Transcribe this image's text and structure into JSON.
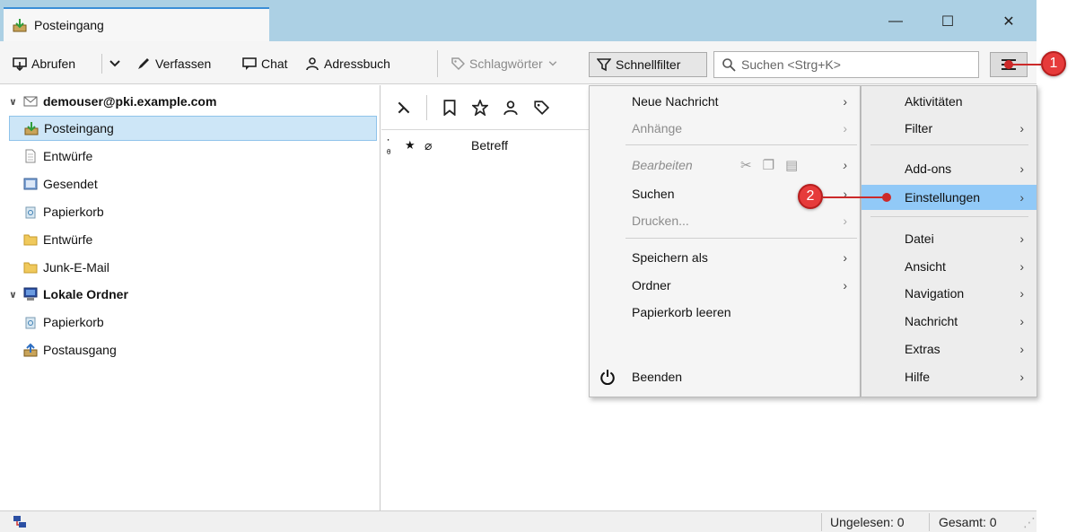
{
  "window": {
    "tab_title": "Posteingang",
    "controls": {
      "minimize": "—",
      "maximize": "☐",
      "close": "✕"
    }
  },
  "toolbar": {
    "get_messages": "Abrufen",
    "compose": "Verfassen",
    "chat": "Chat",
    "address_book": "Adressbuch",
    "tags": "Schlagwörter",
    "quick_filter": "Schnellfilter",
    "search_placeholder": "Suchen <Strg+K>"
  },
  "folders": [
    {
      "label": "demouser@pki.example.com",
      "type": "account"
    },
    {
      "label": "Posteingang",
      "type": "inbox",
      "selected": true
    },
    {
      "label": "Entwürfe",
      "type": "drafts"
    },
    {
      "label": "Gesendet",
      "type": "sent"
    },
    {
      "label": "Papierkorb",
      "type": "trash"
    },
    {
      "label": "Entwürfe",
      "type": "folder"
    },
    {
      "label": "Junk-E-Mail",
      "type": "folder"
    },
    {
      "label": "Lokale Ordner",
      "type": "account"
    },
    {
      "label": "Papierkorb",
      "type": "trash"
    },
    {
      "label": "Postausgang",
      "type": "outbox"
    }
  ],
  "thread": {
    "column_subject": "Betreff"
  },
  "app_menu_left": [
    {
      "label": "Neue Nachricht",
      "submenu": true,
      "disabled": false
    },
    {
      "label": "Anhänge",
      "submenu": true,
      "disabled": true
    },
    {
      "label": "Bearbeiten",
      "submenu": true,
      "disabled": true,
      "italic": true
    },
    {
      "label": "Suchen",
      "submenu": true,
      "disabled": false
    },
    {
      "label": "Drucken...",
      "submenu": true,
      "disabled": true
    },
    {
      "label": "Speichern als",
      "submenu": true,
      "disabled": false
    },
    {
      "label": "Ordner",
      "submenu": true,
      "disabled": false
    },
    {
      "label": "Papierkorb leeren",
      "submenu": false,
      "disabled": false
    },
    {
      "label": "Beenden",
      "submenu": false,
      "disabled": false
    }
  ],
  "app_menu_right": [
    {
      "label": "Aktivitäten",
      "submenu": false
    },
    {
      "label": "Filter",
      "submenu": true
    },
    {
      "label": "Add-ons",
      "submenu": true
    },
    {
      "label": "Einstellungen",
      "submenu": true,
      "highlight": true
    },
    {
      "label": "Datei",
      "submenu": true
    },
    {
      "label": "Ansicht",
      "submenu": true
    },
    {
      "label": "Navigation",
      "submenu": true
    },
    {
      "label": "Nachricht",
      "submenu": true
    },
    {
      "label": "Extras",
      "submenu": true
    },
    {
      "label": "Hilfe",
      "submenu": true
    }
  ],
  "callouts": {
    "one": "1",
    "two": "2"
  },
  "status": {
    "unread": "Ungelesen: 0",
    "total": "Gesamt: 0"
  },
  "colors": {
    "accent": "#3b8ed6",
    "highlight": "#91c9f7",
    "callout": "#e63b3b",
    "titlebar": "#acd0e4"
  }
}
